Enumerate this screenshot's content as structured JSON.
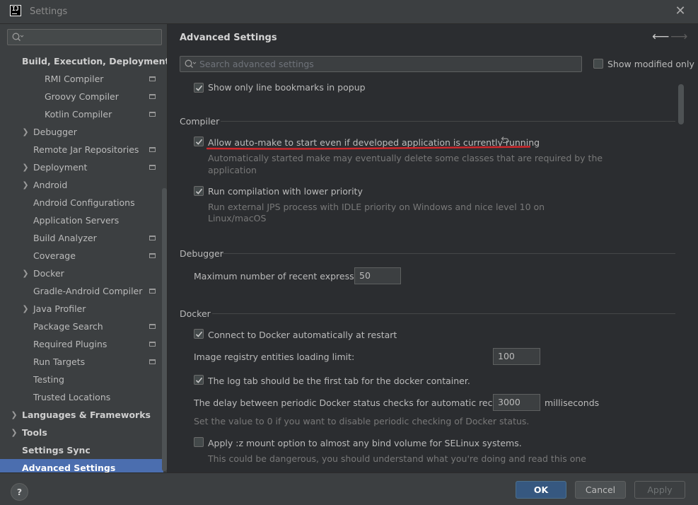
{
  "window": {
    "title": "Settings"
  },
  "sidebar": {
    "search_placeholder": "",
    "items": [
      {
        "label": "Build, Execution, Deployment",
        "bold": true
      },
      {
        "label": "RMI Compiler"
      },
      {
        "label": "Groovy Compiler"
      },
      {
        "label": "Kotlin Compiler"
      },
      {
        "label": "Debugger"
      },
      {
        "label": "Remote Jar Repositories"
      },
      {
        "label": "Deployment"
      },
      {
        "label": "Android"
      },
      {
        "label": "Android Configurations"
      },
      {
        "label": "Application Servers"
      },
      {
        "label": "Build Analyzer"
      },
      {
        "label": "Coverage"
      },
      {
        "label": "Docker"
      },
      {
        "label": "Gradle-Android Compiler"
      },
      {
        "label": "Java Profiler"
      },
      {
        "label": "Package Search"
      },
      {
        "label": "Required Plugins"
      },
      {
        "label": "Run Targets"
      },
      {
        "label": "Testing"
      },
      {
        "label": "Trusted Locations"
      },
      {
        "label": "Languages & Frameworks",
        "bold": true
      },
      {
        "label": "Tools",
        "bold": true
      },
      {
        "label": "Settings Sync",
        "bold": true
      },
      {
        "label": "Advanced Settings",
        "bold": true,
        "selected": true
      }
    ]
  },
  "main": {
    "title": "Advanced Settings",
    "search_placeholder": "Search advanced settings",
    "show_modified_label": "Show modified only",
    "show_modified_checked": false,
    "bookmarks_popup": {
      "label": "Show only line bookmarks in popup",
      "checked": true
    },
    "compiler": {
      "header": "Compiler",
      "auto_make": {
        "label": "Allow auto-make to start even if developed application is currently running",
        "checked": true,
        "desc_line1": "Automatically started make may eventually delete some classes that are required by the",
        "desc_line2": "application"
      },
      "lower_priority": {
        "label": "Run compilation with lower priority",
        "checked": true,
        "desc_line1": "Run external JPS process with IDLE priority on Windows and nice level 10 on",
        "desc_line2": "Linux/macOS"
      }
    },
    "debugger": {
      "header": "Debugger",
      "max_expr_label": "Maximum number of recent expressions:",
      "max_expr_value": "50"
    },
    "docker": {
      "header": "Docker",
      "connect_auto": {
        "label": "Connect to Docker automatically at restart",
        "checked": true
      },
      "registry_limit_label": "Image registry entities loading limit:",
      "registry_limit_value": "100",
      "log_tab": {
        "label": "The log tab should be the first tab for the docker container.",
        "checked": true
      },
      "delay_label": "The delay between periodic Docker status checks for automatic reconnection:",
      "delay_value": "3000",
      "delay_unit": "milliseconds",
      "delay_desc": "Set the value to 0 if you want to disable periodic checking of Docker status.",
      "mount_option": {
        "label": "Apply :z mount option to almost any bind volume for SELinux systems.",
        "checked": false
      },
      "mount_desc": "This could be dangerous, you should understand what you're doing and read this one"
    }
  },
  "footer": {
    "help_label": "?",
    "ok_label": "OK",
    "cancel_label": "Cancel",
    "apply_label": "Apply"
  },
  "colors": {
    "selection": "#4b6eaf",
    "annotation_red": "#d0282c",
    "ok_button": "#365880"
  }
}
